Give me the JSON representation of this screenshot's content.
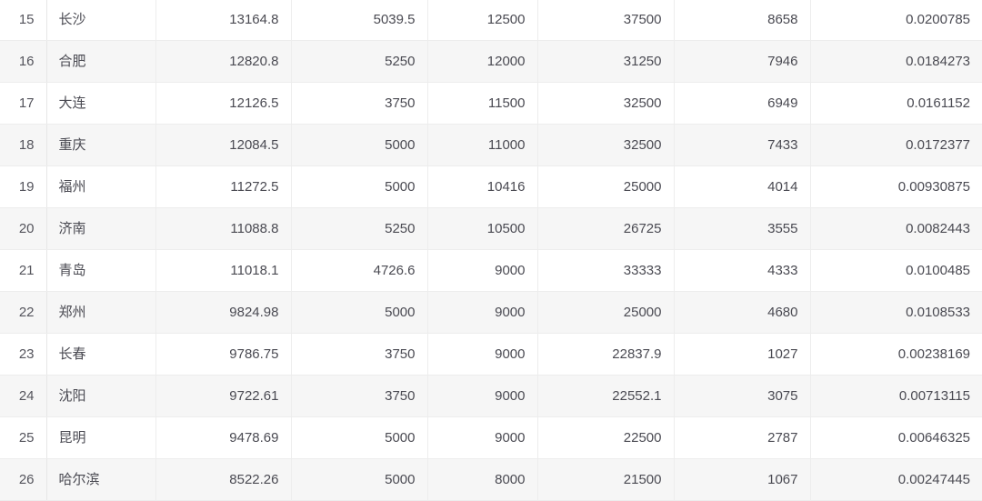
{
  "table": {
    "row_count": 12,
    "column_count": 8,
    "colors": {
      "text": "#4a4a52",
      "border": "#ededed",
      "row_alt_background": "#f6f6f6",
      "row_background": "#ffffff"
    },
    "rows": [
      {
        "index": "15",
        "city": "长沙",
        "v1": "13164.8",
        "v2": "5039.5",
        "v3": "12500",
        "v4": "37500",
        "v5": "8658",
        "v6": "0.0200785",
        "shaded": false
      },
      {
        "index": "16",
        "city": "合肥",
        "v1": "12820.8",
        "v2": "5250",
        "v3": "12000",
        "v4": "31250",
        "v5": "7946",
        "v6": "0.0184273",
        "shaded": true
      },
      {
        "index": "17",
        "city": "大连",
        "v1": "12126.5",
        "v2": "3750",
        "v3": "11500",
        "v4": "32500",
        "v5": "6949",
        "v6": "0.0161152",
        "shaded": false
      },
      {
        "index": "18",
        "city": "重庆",
        "v1": "12084.5",
        "v2": "5000",
        "v3": "11000",
        "v4": "32500",
        "v5": "7433",
        "v6": "0.0172377",
        "shaded": true
      },
      {
        "index": "19",
        "city": "福州",
        "v1": "11272.5",
        "v2": "5000",
        "v3": "10416",
        "v4": "25000",
        "v5": "4014",
        "v6": "0.00930875",
        "shaded": false
      },
      {
        "index": "20",
        "city": "济南",
        "v1": "11088.8",
        "v2": "5250",
        "v3": "10500",
        "v4": "26725",
        "v5": "3555",
        "v6": "0.0082443",
        "shaded": true
      },
      {
        "index": "21",
        "city": "青岛",
        "v1": "11018.1",
        "v2": "4726.6",
        "v3": "9000",
        "v4": "33333",
        "v5": "4333",
        "v6": "0.0100485",
        "shaded": false
      },
      {
        "index": "22",
        "city": "郑州",
        "v1": "9824.98",
        "v2": "5000",
        "v3": "9000",
        "v4": "25000",
        "v5": "4680",
        "v6": "0.0108533",
        "shaded": true
      },
      {
        "index": "23",
        "city": "长春",
        "v1": "9786.75",
        "v2": "3750",
        "v3": "9000",
        "v4": "22837.9",
        "v5": "1027",
        "v6": "0.00238169",
        "shaded": false
      },
      {
        "index": "24",
        "city": "沈阳",
        "v1": "9722.61",
        "v2": "3750",
        "v3": "9000",
        "v4": "22552.1",
        "v5": "3075",
        "v6": "0.00713115",
        "shaded": true
      },
      {
        "index": "25",
        "city": "昆明",
        "v1": "9478.69",
        "v2": "5000",
        "v3": "9000",
        "v4": "22500",
        "v5": "2787",
        "v6": "0.00646325",
        "shaded": false
      },
      {
        "index": "26",
        "city": "哈尔滨",
        "v1": "8522.26",
        "v2": "5000",
        "v3": "8000",
        "v4": "21500",
        "v5": "1067",
        "v6": "0.00247445",
        "shaded": true
      }
    ]
  }
}
